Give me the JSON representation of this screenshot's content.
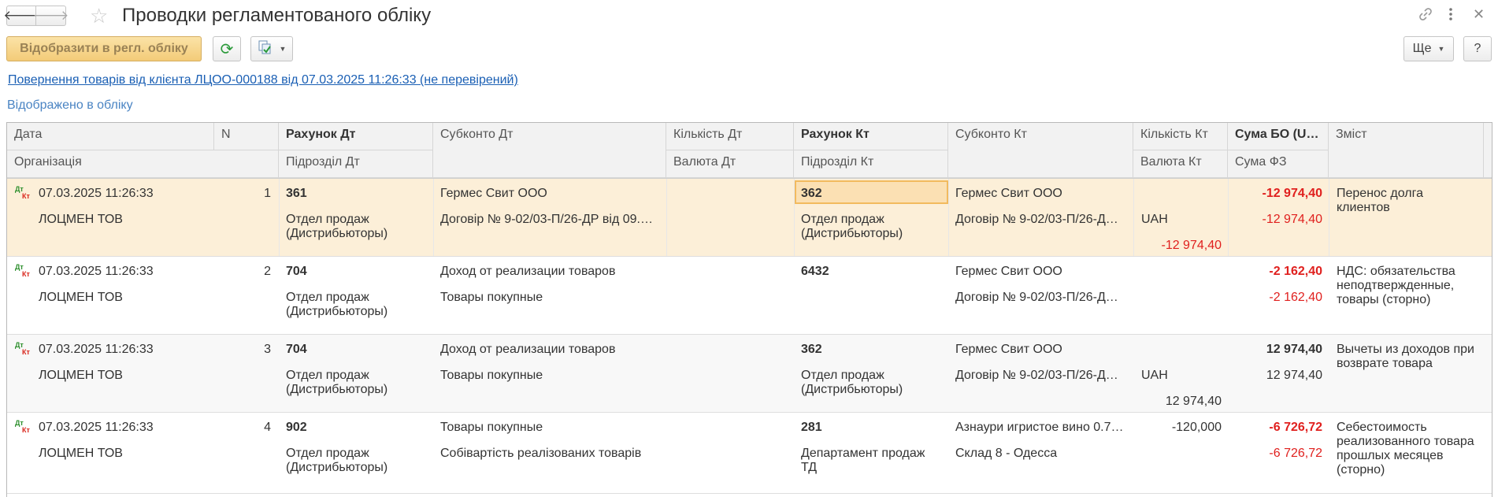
{
  "window": {
    "title": "Проводки регламентованого обліку"
  },
  "toolbar": {
    "post_label": "Відобразити в регл. обліку",
    "more_label": "Ще",
    "help_label": "?"
  },
  "document": {
    "link_text": "Повернення товарів від клієнта ЛЦОО-000188 від 07.03.2025 11:26:33 (не перевірений)",
    "status_text": "Відображено в обліку"
  },
  "columns": {
    "date": "Дата",
    "org": "Організація",
    "n": "N",
    "acct_dt": "Рахунок Дт",
    "dept_dt": "Підрозділ Дт",
    "sub_dt": "Субконто Дт",
    "qty_dt": "Кількість Дт",
    "cur_dt": "Валюта Дт",
    "acct_kt": "Рахунок Кт",
    "dept_kt": "Підрозділ Кт",
    "sub_kt": "Субконто Кт",
    "qty_kt": "Кількість Кт",
    "cur_kt": "Валюта Кт",
    "sum_bo": "Сума БО (U…",
    "sum_fz": "Сума ФЗ",
    "content": "Зміст"
  },
  "icon_label": {
    "dt": "Дт",
    "kt": "Кт"
  },
  "rows": [
    {
      "date": "07.03.2025 11:26:33",
      "org": "ЛОЦМЕН ТОВ",
      "n": "1",
      "acct_dt": "361",
      "dept_dt": "Отдел продаж (Дистрибьюторы)",
      "sub_dt_1": "Гермес Свит ООО",
      "sub_dt_2": "Договір № 9-02/03-П/26-ДР від 09.…",
      "qty_dt": "",
      "cur_dt": "",
      "acct_kt": "362",
      "dept_kt": "Отдел продаж (Дистрибьюторы)",
      "sub_kt_1": "Гермес Свит ООО",
      "sub_kt_2": "Договір № 9-02/03-П/26-Д…",
      "qty_kt": "",
      "cur_kt": "UAH",
      "cur_kt_amount": "-12 974,40",
      "sum_bo": "-12 974,40",
      "sum_fz": "-12 974,40",
      "content": "Перенос долга клиентов"
    },
    {
      "date": "07.03.2025 11:26:33",
      "org": "ЛОЦМЕН ТОВ",
      "n": "2",
      "acct_dt": "704",
      "dept_dt": "Отдел продаж (Дистрибьюторы)",
      "sub_dt_1": "Доход от реализации товаров",
      "sub_dt_2": "Товары покупные",
      "qty_dt": "",
      "cur_dt": "",
      "acct_kt": "6432",
      "dept_kt": "",
      "sub_kt_1": "Гермес Свит ООО",
      "sub_kt_2": "Договір № 9-02/03-П/26-Д…",
      "qty_kt": "",
      "cur_kt": "",
      "cur_kt_amount": "",
      "sum_bo": "-2 162,40",
      "sum_fz": "-2 162,40",
      "content": "НДС: обязательства неподтвержденные, товары (сторно)"
    },
    {
      "date": "07.03.2025 11:26:33",
      "org": "ЛОЦМЕН ТОВ",
      "n": "3",
      "acct_dt": "704",
      "dept_dt": "Отдел продаж (Дистрибьюторы)",
      "sub_dt_1": "Доход от реализации товаров",
      "sub_dt_2": "Товары покупные",
      "qty_dt": "",
      "cur_dt": "",
      "acct_kt": "362",
      "dept_kt": "Отдел продаж (Дистрибьюторы)",
      "sub_kt_1": "Гермес Свит ООО",
      "sub_kt_2": "Договір № 9-02/03-П/26-Д…",
      "qty_kt": "",
      "cur_kt": "UAH",
      "cur_kt_amount": "12 974,40",
      "sum_bo": "12 974,40",
      "sum_fz": "12 974,40",
      "content": "Вычеты из доходов при возврате товара"
    },
    {
      "date": "07.03.2025 11:26:33",
      "org": "ЛОЦМЕН ТОВ",
      "n": "4",
      "acct_dt": "902",
      "dept_dt": "Отдел продаж (Дистрибьюторы)",
      "sub_dt_1": "Товары покупные",
      "sub_dt_2": "Собівартість реалізованих товарів",
      "qty_dt": "",
      "cur_dt": "",
      "acct_kt": "281",
      "dept_kt": "Департамент продаж ТД",
      "sub_kt_1": "Азнаури игристое вино 0.7…",
      "sub_kt_2": "Склад 8 - Одесса",
      "qty_kt": "-120,000",
      "cur_kt": "",
      "cur_kt_amount": "",
      "sum_bo": "-6 726,72",
      "sum_fz": "-6 726,72",
      "content": "Себестоимость реализованного товара прошлых месяцев (сторно)"
    }
  ]
}
